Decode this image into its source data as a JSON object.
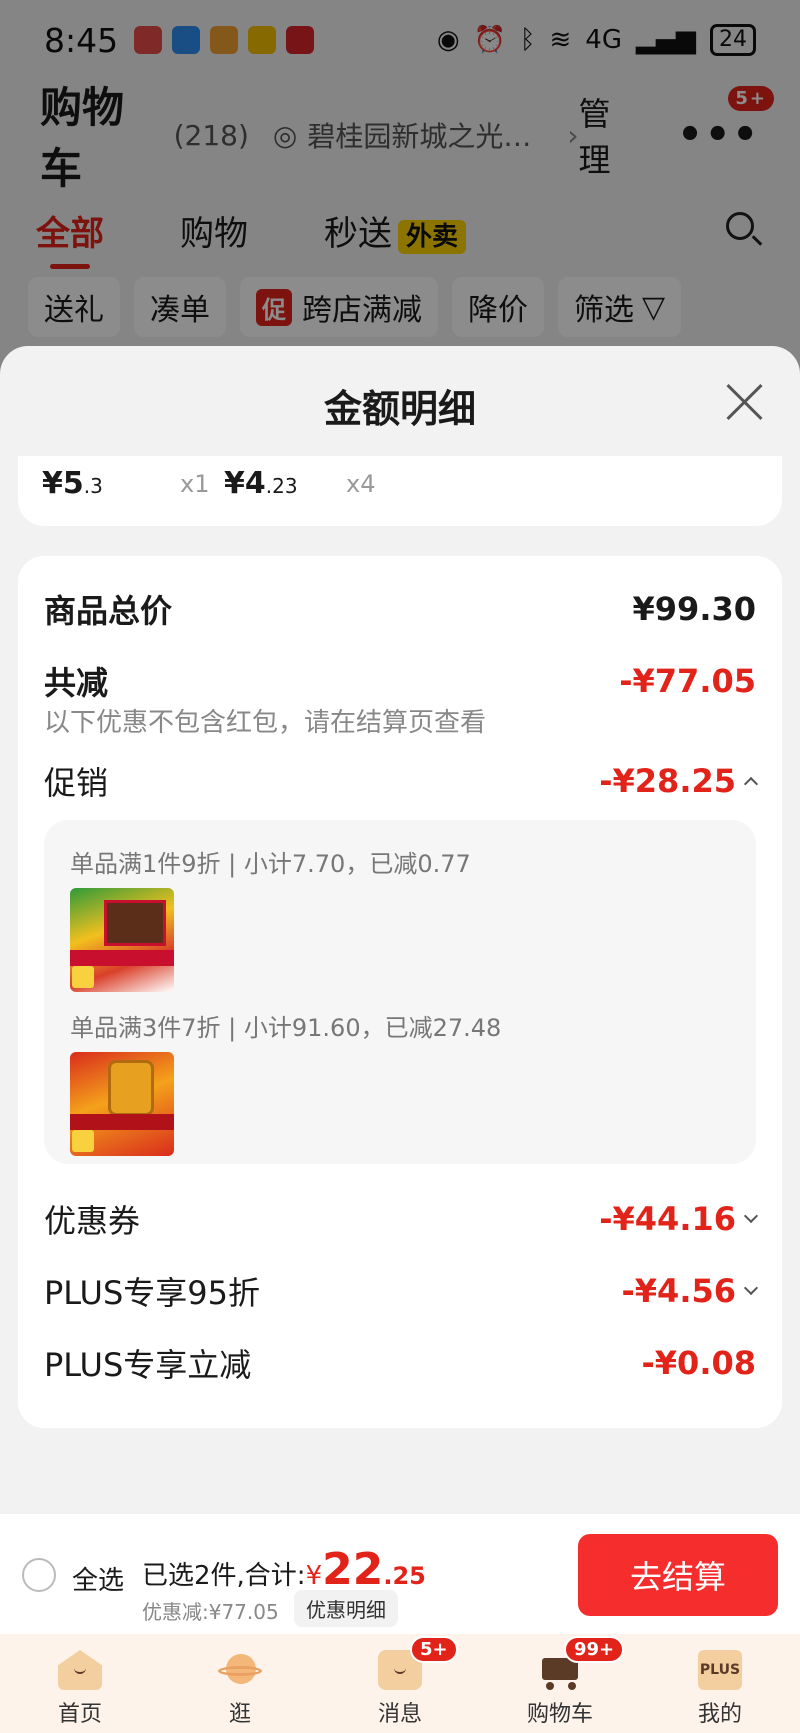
{
  "status_bar": {
    "time": "8:45",
    "battery": "24",
    "network": "4G"
  },
  "header": {
    "title": "购物车",
    "count": "(218)",
    "address": "碧桂园新城之光2…",
    "manage": "管理",
    "more_badge": "5+"
  },
  "tabs": [
    {
      "label": "全部",
      "active": true
    },
    {
      "label": "购物"
    },
    {
      "label": "秒送",
      "tag": "外卖"
    }
  ],
  "filters": [
    "送礼",
    "凑单",
    "跨店满减",
    "降价",
    "筛选"
  ],
  "filter_promo_tag": "促",
  "sheet": {
    "title": "金额明细",
    "items": [
      {
        "price_yen": "¥",
        "price_int": "5",
        "price_dec": ".3",
        "qty": "x1"
      },
      {
        "price_yen": "¥",
        "price_int": "4",
        "price_dec": ".23",
        "qty": "x4"
      }
    ],
    "goods_total_label": "商品总价",
    "goods_total_value": "¥99.30",
    "reduce_label": "共减",
    "reduce_value": "-¥77.05",
    "reduce_note": "以下优惠不包含红包，请在结算页查看",
    "promo_label": "促销",
    "promo_value": "-¥28.25",
    "promo_details": [
      {
        "text": "单品满1件9折 | 小计7.70，已减0.77",
        "image": "kitkat-gift-box"
      },
      {
        "text": "单品满3件7折 | 小计91.60，已减27.48",
        "image": "nut-jar-gift-box"
      }
    ],
    "coupon_label": "优惠券",
    "coupon_value": "-¥44.16",
    "plus95_label": "PLUS专享95折",
    "plus95_value": "-¥4.56",
    "plus_instant_label": "PLUS专享立减",
    "plus_instant_value": "-¥0.08"
  },
  "checkout": {
    "select_all": "全选",
    "selected_text": "已选2件,合计:",
    "currency": "¥",
    "total_int": "22",
    "total_dec": ".25",
    "discount_text": "优惠减:¥77.05",
    "detail_chip": "优惠明细",
    "pay_button": "去结算"
  },
  "bottom_nav": [
    {
      "label": "首页",
      "icon": "home-icon"
    },
    {
      "label": "逛",
      "icon": "planet-icon"
    },
    {
      "label": "消息",
      "icon": "message-icon",
      "badge": "5+"
    },
    {
      "label": "购物车",
      "icon": "cart-icon",
      "badge": "99+",
      "active": true
    },
    {
      "label": "我的",
      "icon": "plus-member-icon",
      "icon_text": "PLUS"
    }
  ],
  "colors": {
    "brand_red": "#e2231a",
    "pay_button": "#f52d2d",
    "waimai_yellow": "#ffd400"
  }
}
